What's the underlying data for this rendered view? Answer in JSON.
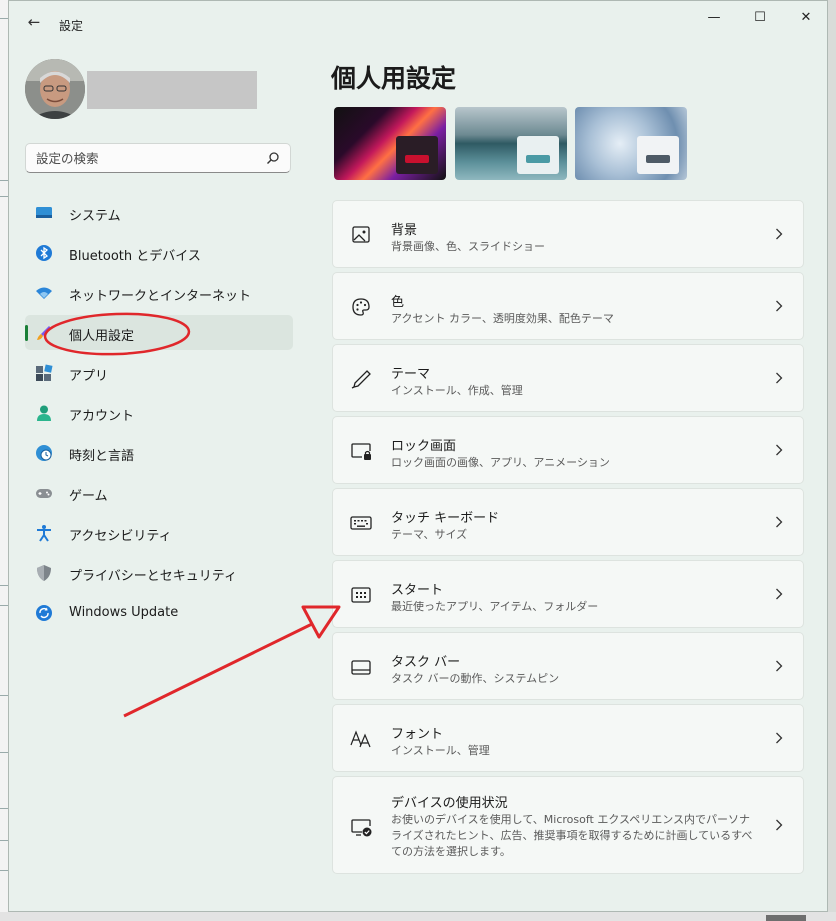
{
  "window": {
    "title": "設定",
    "back_glyph": "←",
    "minimize_glyph": "—",
    "maximize_glyph": "☐",
    "close_glyph": "✕"
  },
  "search": {
    "placeholder": "設定の検索",
    "icon": "search-icon"
  },
  "sidebar": {
    "items": [
      {
        "label": "システム",
        "icon": "system-icon",
        "active": false
      },
      {
        "label": "Bluetooth とデバイス",
        "icon": "bluetooth-icon",
        "active": false
      },
      {
        "label": "ネットワークとインターネット",
        "icon": "wifi-icon",
        "active": false
      },
      {
        "label": "個人用設定",
        "icon": "brush-icon",
        "active": true
      },
      {
        "label": "アプリ",
        "icon": "apps-icon",
        "active": false
      },
      {
        "label": "アカウント",
        "icon": "account-icon",
        "active": false
      },
      {
        "label": "時刻と言語",
        "icon": "globe-clock-icon",
        "active": false
      },
      {
        "label": "ゲーム",
        "icon": "gamepad-icon",
        "active": false
      },
      {
        "label": "アクセシビリティ",
        "icon": "accessibility-icon",
        "active": false
      },
      {
        "label": "プライバシーとセキュリティ",
        "icon": "shield-icon",
        "active": false
      },
      {
        "label": "Windows Update",
        "icon": "update-icon",
        "active": false
      }
    ]
  },
  "main": {
    "title": "個人用設定",
    "themes": [
      {
        "name": "theme-glow",
        "accent": "#c8102e"
      },
      {
        "name": "theme-lake",
        "accent": "#4a9aa5"
      },
      {
        "name": "theme-bloom",
        "accent": "#4e5a66"
      }
    ],
    "cards": [
      {
        "title": "背景",
        "subtitle": "背景画像、色、スライドショー",
        "icon": "image-icon"
      },
      {
        "title": "色",
        "subtitle": "アクセント カラー、透明度効果、配色テーマ",
        "icon": "palette-icon"
      },
      {
        "title": "テーマ",
        "subtitle": "インストール、作成、管理",
        "icon": "pen-icon"
      },
      {
        "title": "ロック画面",
        "subtitle": "ロック画面の画像、アプリ、アニメーション",
        "icon": "lock-screen-icon"
      },
      {
        "title": "タッチ キーボード",
        "subtitle": "テーマ、サイズ",
        "icon": "keyboard-icon"
      },
      {
        "title": "スタート",
        "subtitle": "最近使ったアプリ、アイテム、フォルダー",
        "icon": "start-menu-icon"
      },
      {
        "title": "タスク バー",
        "subtitle": "タスク バーの動作、システムピン",
        "icon": "taskbar-icon"
      },
      {
        "title": "フォント",
        "subtitle": "インストール、管理",
        "icon": "font-icon"
      },
      {
        "title": "デバイスの使用状況",
        "subtitle": "お使いのデバイスを使用して、Microsoft エクスペリエンス内でパーソナライズされたヒント、広告、推奨事項を取得するために計画しているすべての方法を選択します。",
        "icon": "device-usage-icon"
      }
    ]
  },
  "colors": {
    "window_bg": "#e9f1ed",
    "card_bg": "#f5f8f6",
    "active_indicator": "#1a7f37",
    "annotation_red": "#e0272b"
  },
  "annotations": [
    {
      "type": "ellipse",
      "target": "個人用設定"
    },
    {
      "type": "arrow",
      "target": "スタート"
    }
  ]
}
